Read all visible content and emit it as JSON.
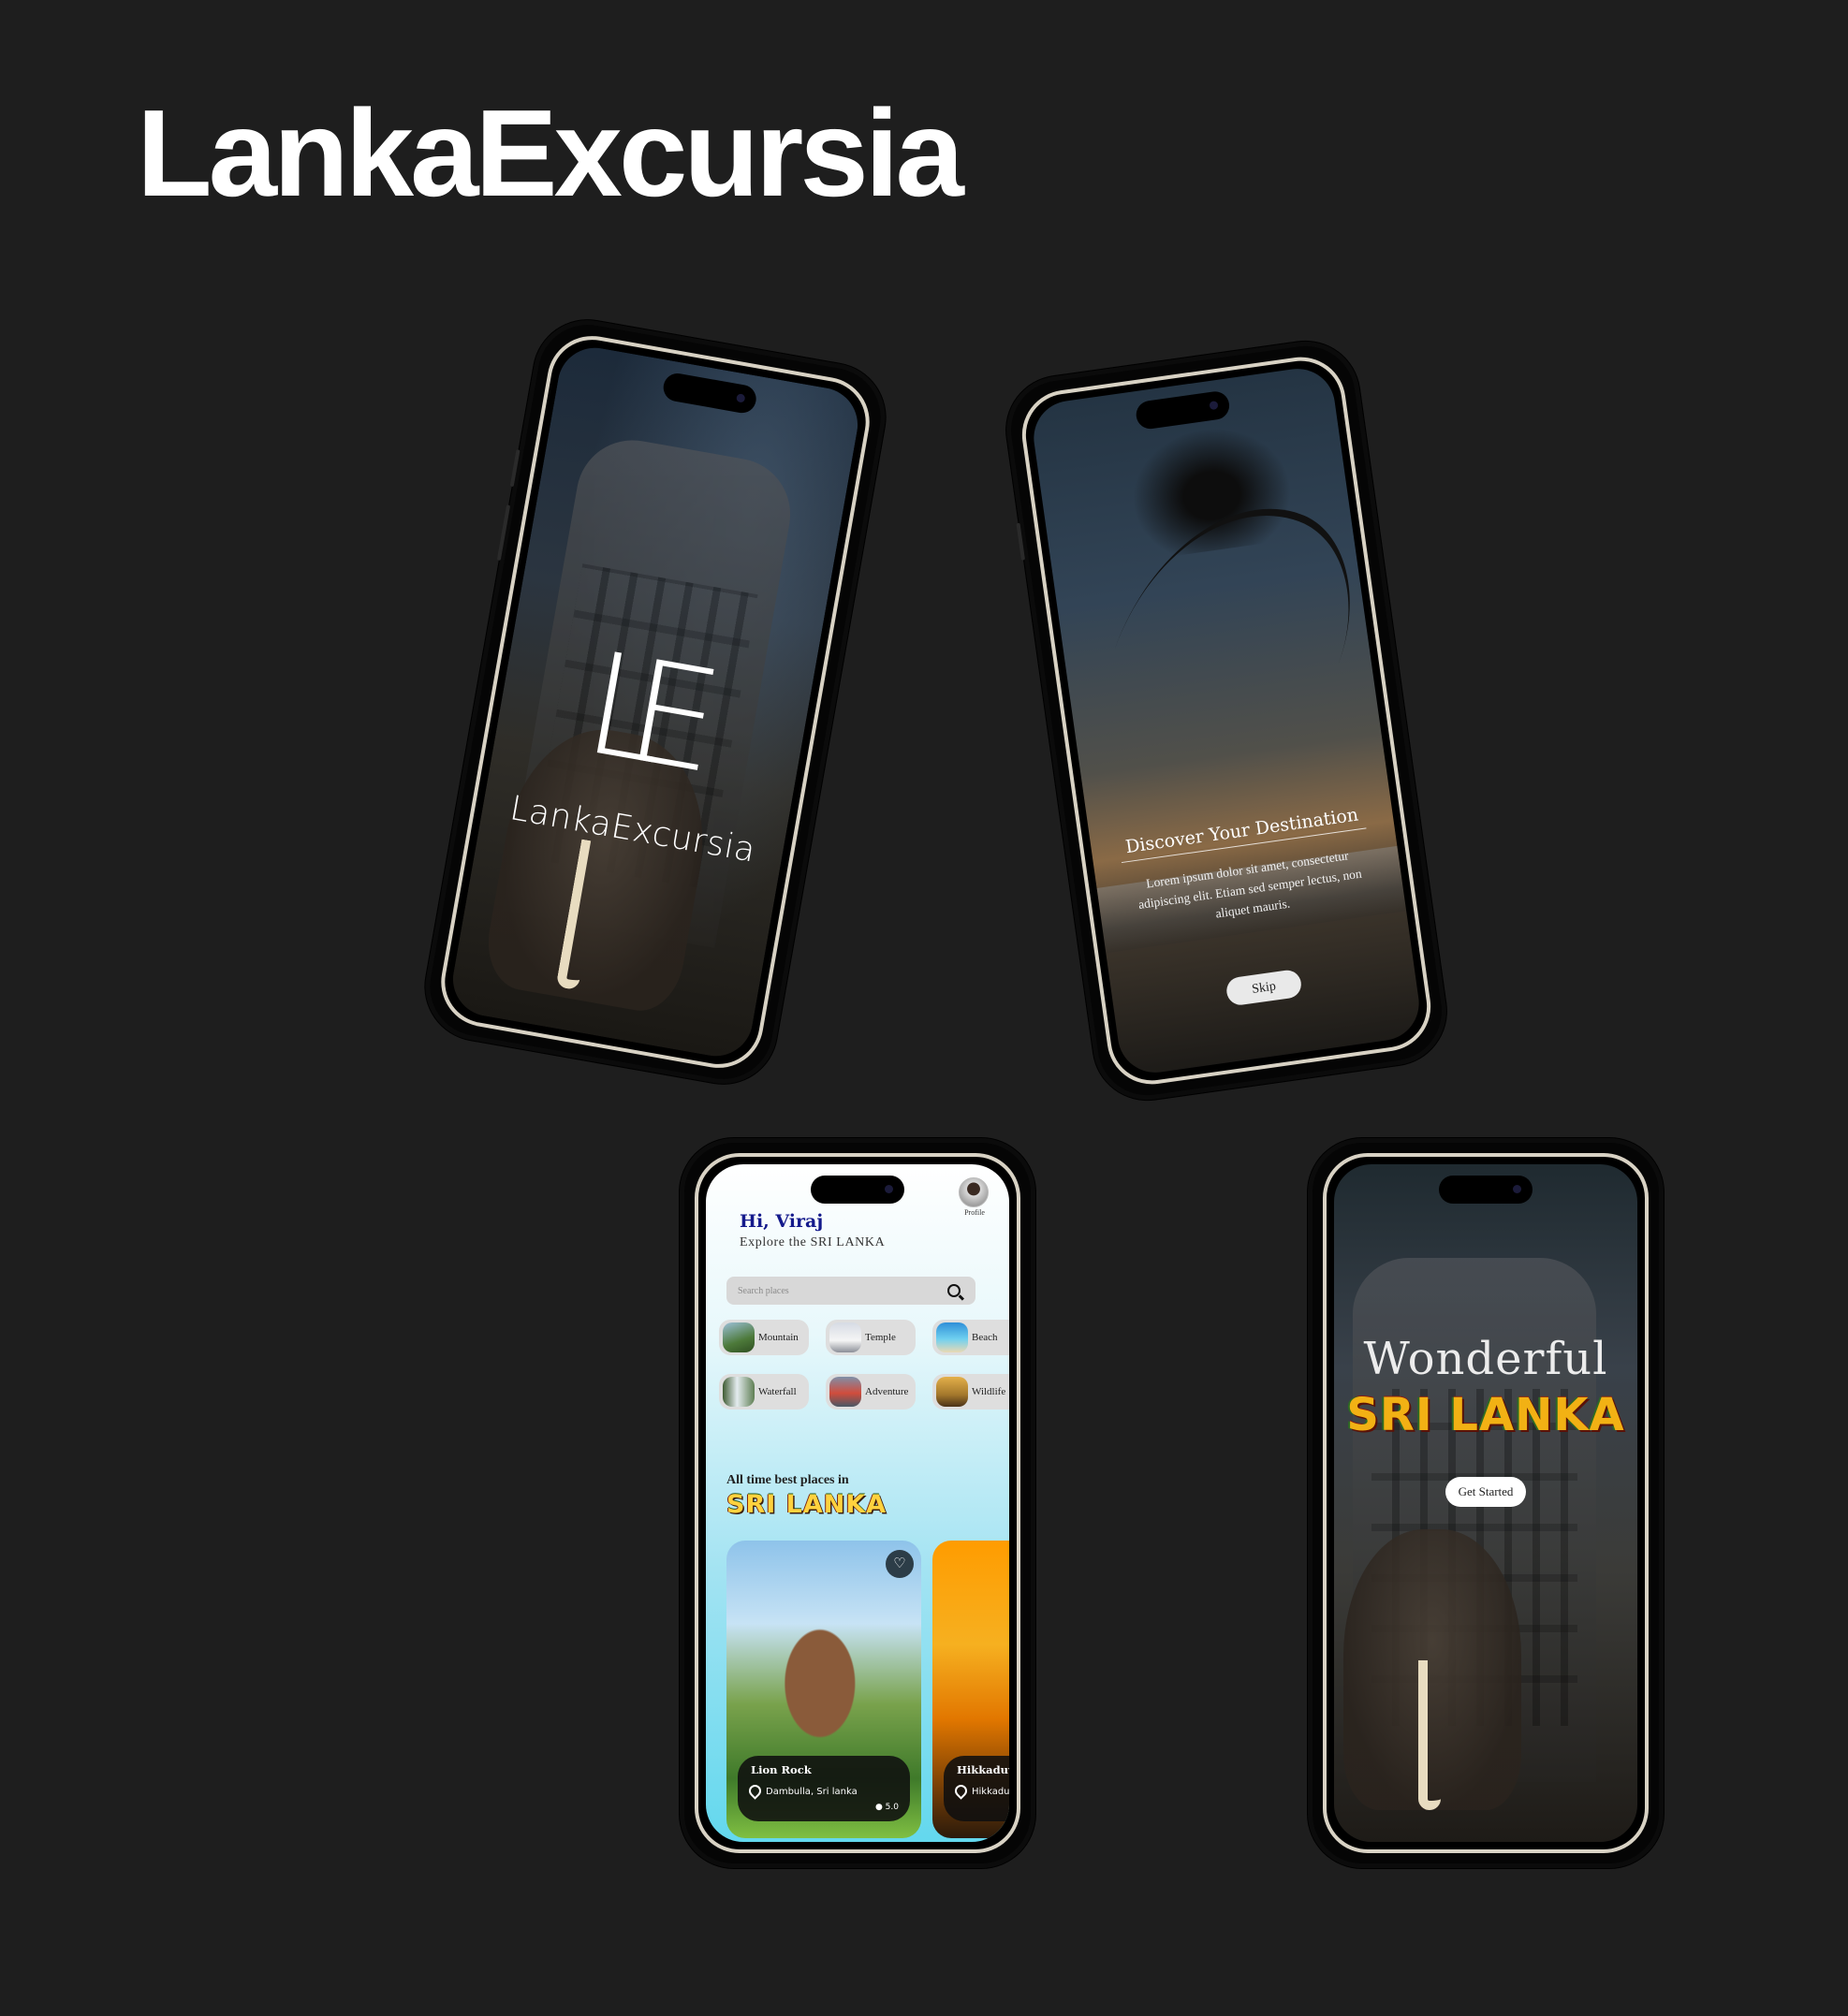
{
  "page": {
    "title": "LankaExcursia"
  },
  "splash": {
    "logo_mark": "LE",
    "logo_text": "LankaExcursia"
  },
  "onboarding": {
    "title": "Discover Your Destination",
    "body": "Lorem ipsum dolor sit amet, consectetur adipiscing elit. Etiam sed semper lectus, non aliquet mauris.",
    "skip_label": "Skip"
  },
  "home": {
    "greeting": "Hi, Viraj",
    "subtitle": "Explore the SRI LANKA",
    "profile_label": "Profile",
    "search_placeholder": "Search places",
    "categories": [
      {
        "label": "Mountain",
        "color": "#4d7a3a"
      },
      {
        "label": "Temple",
        "color": "#c9ccd6"
      },
      {
        "label": "Beach",
        "color": "#2f8fd8"
      },
      {
        "label": "Waterfall",
        "color": "#5f7f54"
      },
      {
        "label": "Adventure",
        "color": "#7f8fa8"
      },
      {
        "label": "Wildlife",
        "color": "#a4782c"
      }
    ],
    "section_label": "All time best places in",
    "section_country": "SRI LANKA",
    "places": [
      {
        "name": "Lion Rock",
        "location": "Dambulla, Sri lanka",
        "rating": "5.0"
      },
      {
        "name": "Hikkaduwa",
        "location": "Hikkaduwa,"
      }
    ]
  },
  "getstarted": {
    "headline": "Wonderful",
    "country": "SRI LANKA",
    "button_label": "Get Started"
  },
  "colors": {
    "background": "#1e1e1e",
    "greeting": "#141a8c",
    "frame": "#d8d2c4"
  }
}
